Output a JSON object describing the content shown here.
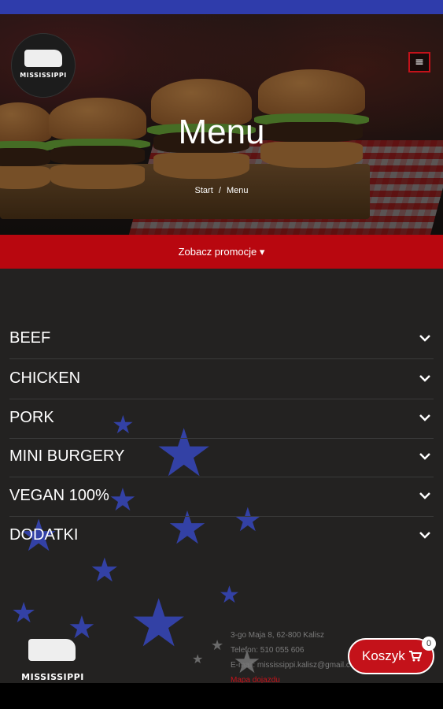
{
  "header": {
    "logo_text": "MISSISSIPPI",
    "menu_icon": "hamburger-icon"
  },
  "hero": {
    "title": "Menu",
    "breadcrumb": {
      "start": "Start",
      "separator": "/",
      "current": "Menu"
    }
  },
  "promo": {
    "label": "Zobacz promocje",
    "icon": "caret-down-icon"
  },
  "categories": [
    {
      "label": "BEEF"
    },
    {
      "label": "CHICKEN"
    },
    {
      "label": "PORK"
    },
    {
      "label": "MINI BURGERY"
    },
    {
      "label": "VEGAN 100%"
    },
    {
      "label": "DODATKI"
    }
  ],
  "footer": {
    "logo_text": "MISSISSIPPI",
    "address": "3-go Maja 8, 62-800 Kalisz",
    "phone": "Telefon: 510 055 606",
    "email": "E-mail: mississippi.kalisz@gmail.com",
    "map_link": "Mapa dojazdu"
  },
  "cart": {
    "label": "Koszyk",
    "count": "0",
    "icon": "cart-icon"
  },
  "colors": {
    "topbar": "#2f3cab",
    "promo": "#b8070f",
    "accent": "#c4121a",
    "background": "#232221",
    "star": "#3341a5"
  }
}
